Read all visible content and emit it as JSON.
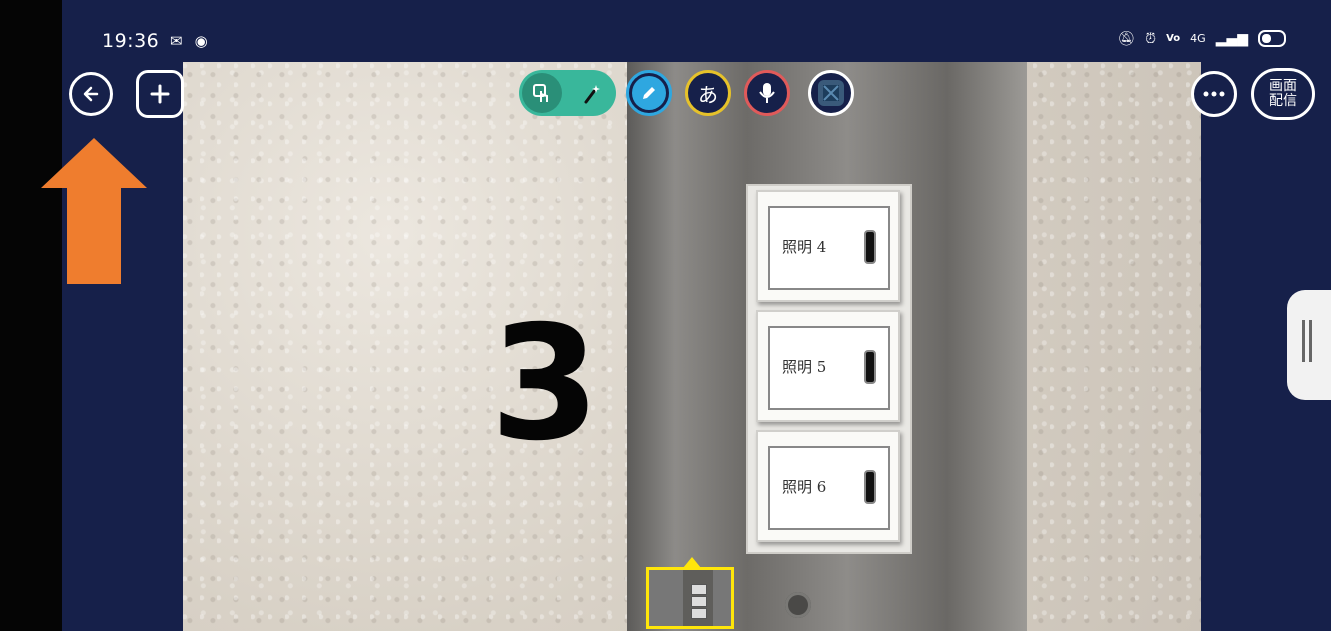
{
  "status_bar": {
    "time": "19:36",
    "network_label": "4G"
  },
  "toolbar": {
    "back_icon": "arrow-left-icon",
    "add_icon": "plus-icon",
    "text_tool_label": "あ",
    "more_icon": "ellipsis-icon",
    "screen_share_label": "画面\n配信"
  },
  "camera": {
    "overlay_number": "3",
    "switches": [
      {
        "label": "照明 4"
      },
      {
        "label": "照明 5"
      },
      {
        "label": "照明 6"
      }
    ]
  },
  "colors": {
    "app_background": "#16204a",
    "toggle_green": "#39b79b",
    "pen_blue": "#2ea7e0",
    "text_yellow": "#e6c22a",
    "mic_red": "#e05a5a",
    "thumbnail_border": "#ffe60a",
    "annotation_arrow": "#ef7d2e"
  }
}
